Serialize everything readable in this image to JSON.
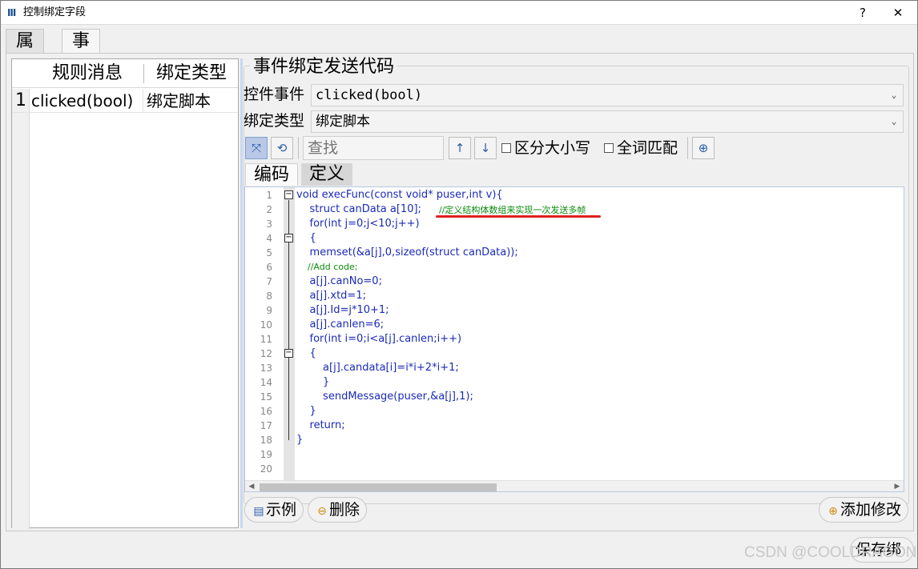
{
  "window": {
    "title": "控制绑定字段",
    "help_btn": "?",
    "close_btn": "✕"
  },
  "outer_tabs": [
    "属性",
    "事件"
  ],
  "rule_table": {
    "headers": [
      "规则消息",
      "绑定类型"
    ],
    "rows": [
      {
        "num": "1",
        "message": "clicked(bool)",
        "type": "绑定脚本"
      }
    ]
  },
  "group": {
    "title": "事件绑定发送代码",
    "control_event_label": "控件事件",
    "control_event_value": "clicked(bool)",
    "bind_type_label": "绑定类型",
    "bind_type_value": "绑定脚本"
  },
  "toolbar": {
    "search_placeholder": "查找",
    "case_label": "区分大小写",
    "whole_word_label": "全词匹配"
  },
  "editor_tabs": [
    "编码",
    "定义"
  ],
  "code_lines": [
    "void execFunc(const void* puser,int v){",
    "    struct canData a[10];",
    "    for(int j=0;j<10;j++)",
    "    {",
    "    memset(&a[j],0,sizeof(struct canData));",
    "    //Add code;",
    "    a[j].canNo=0;",
    "    a[j].xtd=1;",
    "    a[j].Id=j*10+1;",
    "    a[j].canlen=6;",
    "    for(int i=0;i<a[j].canlen;i++)",
    "    {",
    "        a[j].candata[i]=i*i+2*i+1;",
    "        }",
    "        sendMessage(puser,&a[j],1);",
    "    }",
    "    return;",
    "}",
    "",
    ""
  ],
  "inline_comment": "//定义结构体数组来实现一次发送多帧",
  "line_numbers": [
    "1",
    "2",
    "3",
    "4",
    "5",
    "6",
    "7",
    "8",
    "9",
    "10",
    "11",
    "12",
    "13",
    "14",
    "15",
    "16",
    "17",
    "18",
    "19",
    "20"
  ],
  "buttons": {
    "example": "示例",
    "delete": "删除",
    "add_modify": "添加修改",
    "save": "保存绑"
  },
  "watermark": "CSDN @COOLDRAGON"
}
